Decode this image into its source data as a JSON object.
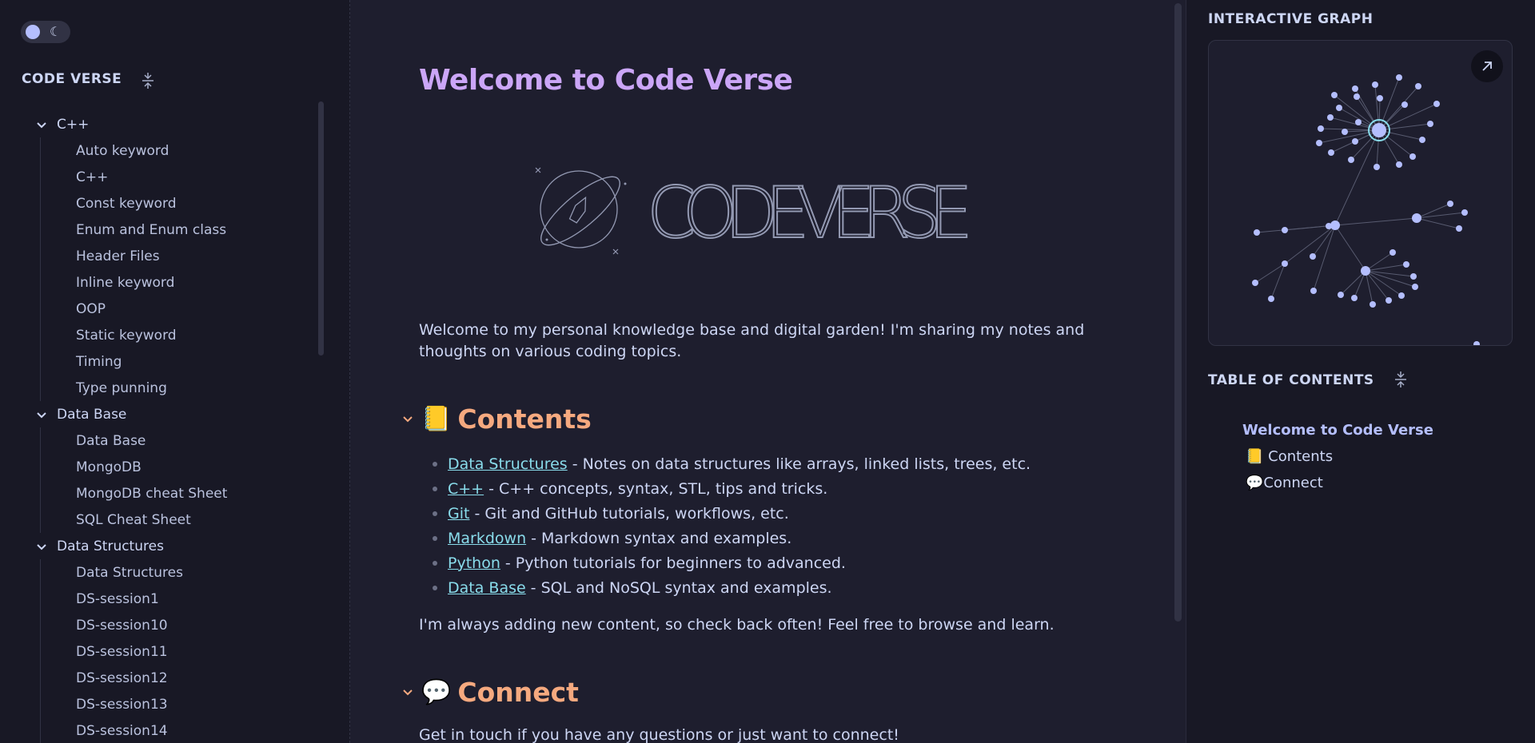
{
  "left": {
    "site_title": "CODE VERSE",
    "folders": [
      {
        "name": "C++",
        "files": [
          "Auto keyword",
          "C++",
          "Const keyword",
          "Enum and Enum class",
          "Header Files",
          "Inline keyword",
          "OOP",
          "Static keyword",
          "Timing",
          "Type punning"
        ]
      },
      {
        "name": "Data Base",
        "files": [
          "Data Base",
          "MongoDB",
          "MongoDB cheat Sheet",
          "SQL Cheat Sheet"
        ]
      },
      {
        "name": "Data Structures",
        "files": [
          "Data Structures",
          "DS-session1",
          "DS-session10",
          "DS-session11",
          "DS-session12",
          "DS-session13",
          "DS-session14"
        ]
      }
    ]
  },
  "main": {
    "title": "Welcome to Code Verse",
    "logo_text": "CODEVERSE",
    "intro": "Welcome to my personal knowledge base and digital garden! I'm sharing my notes and thoughts on various coding topics.",
    "contents_heading": {
      "emoji": "📒",
      "text": "Contents"
    },
    "contents": [
      {
        "link": "Data Structures",
        "desc": "- Notes on data structures like arrays, linked lists, trees, etc."
      },
      {
        "link": "C++",
        "desc": "- C++ concepts, syntax, STL, tips and tricks."
      },
      {
        "link": "Git",
        "desc": "- Git and GitHub tutorials, workflows, etc."
      },
      {
        "link": "Markdown",
        "desc": "- Markdown syntax and examples."
      },
      {
        "link": "Python",
        "desc": "- Python tutorials for beginners to advanced."
      },
      {
        "link": "Data Base",
        "desc": "- SQL and NoSQL syntax and examples."
      }
    ],
    "outro": "I'm always adding new content, so check back often! Feel free to browse and learn.",
    "connect_heading": {
      "emoji": "💬",
      "text": "Connect"
    },
    "connect_text": "Get in touch if you have any questions or just want to connect!"
  },
  "right": {
    "graph_title": "INTERACTIVE GRAPH",
    "toc_title": "TABLE OF CONTENTS",
    "toc": [
      {
        "text": "Welcome to Code Verse",
        "level": 1
      },
      {
        "text": "📒 Contents",
        "level": 2
      },
      {
        "text": "💬Connect",
        "level": 2
      }
    ]
  },
  "colors": {
    "background": "#1e1e2e",
    "sidebar": "#181825",
    "title": "#cba6f7",
    "heading": "#f5a97f",
    "link": "#89dceb",
    "graph_node": "#b4befe"
  },
  "icons": [
    "sun-icon",
    "moon-icon",
    "collapse-icon",
    "chevron-down-icon",
    "arrow-up-right-icon"
  ]
}
